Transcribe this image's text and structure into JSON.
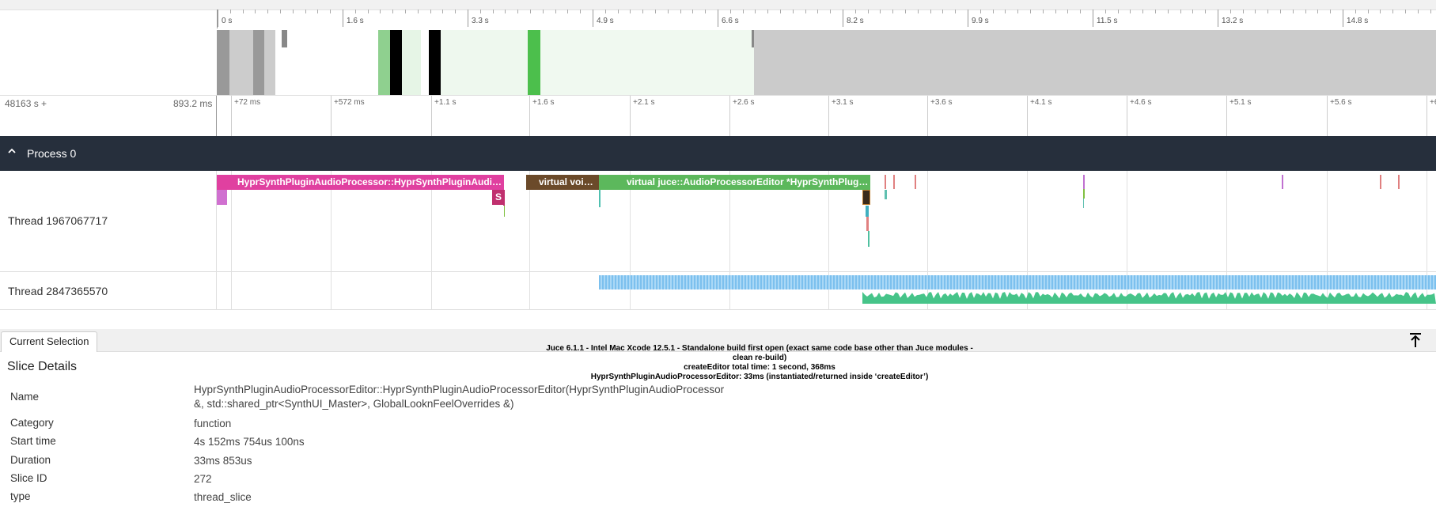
{
  "timeline": {
    "ruler_labels": [
      "0 s",
      "1.6 s",
      "3.3 s",
      "4.9 s",
      "6.6 s",
      "8.2 s",
      "9.9 s",
      "11.5 s",
      "13.2 s",
      "14.8 s"
    ],
    "offset_start": "48163 s +",
    "offset_end": "893.2 ms",
    "offset_labels": [
      "+72 ms",
      "+572 ms",
      "+1.1 s",
      "+1.6 s",
      "+2.1 s",
      "+2.6 s",
      "+3.1 s",
      "+3.6 s",
      "+4.1 s",
      "+4.6 s",
      "+5.1 s",
      "+5.6 s",
      "+6"
    ]
  },
  "process": {
    "label": "Process 0"
  },
  "tracks": [
    {
      "label": "Thread 1967067717",
      "slices": [
        {
          "label": "HyprSynthPluginAudioProcessor::HyprSynthPluginAudioProcessor(...)",
          "color": "#e040a0"
        },
        {
          "label": "S",
          "color": "#c0306e"
        },
        {
          "label": "virtual void juce::...",
          "color": "#6b4a2a"
        },
        {
          "label": "virtual juce::AudioProcessorEditor *HyprSynthPluginAudioProcessor::createEditor()",
          "color": "#5cb85c"
        }
      ]
    },
    {
      "label": "Thread 2847365570"
    }
  ],
  "bottom": {
    "tab": "Current Selection",
    "note_lines": [
      "Juce 6.1.1 - Intel Mac Xcode 12.5.1 - Standalone build first open (exact same code base other than Juce modules -",
      "clean re-build)",
      "createEditor total time: 1 second, 368ms",
      "HyprSynthPluginAudioProcessorEditor: 33ms (instantiated/returned inside ‘createEditor’)"
    ],
    "title": "Slice Details",
    "details": [
      {
        "key": "Name",
        "value": "HyprSynthPluginAudioProcessorEditor::HyprSynthPluginAudioProcessorEditor(HyprSynthPluginAudioProcessor &, std::shared_ptr<SynthUI_Master>, GlobalLooknFeelOverrides &)"
      },
      {
        "key": "Category",
        "value": "function"
      },
      {
        "key": "Start time",
        "value": "4s 152ms 754us 100ns"
      },
      {
        "key": "Duration",
        "value": "33ms 853us"
      },
      {
        "key": "Slice ID",
        "value": "272"
      },
      {
        "key": "type",
        "value": "thread_slice"
      }
    ]
  }
}
